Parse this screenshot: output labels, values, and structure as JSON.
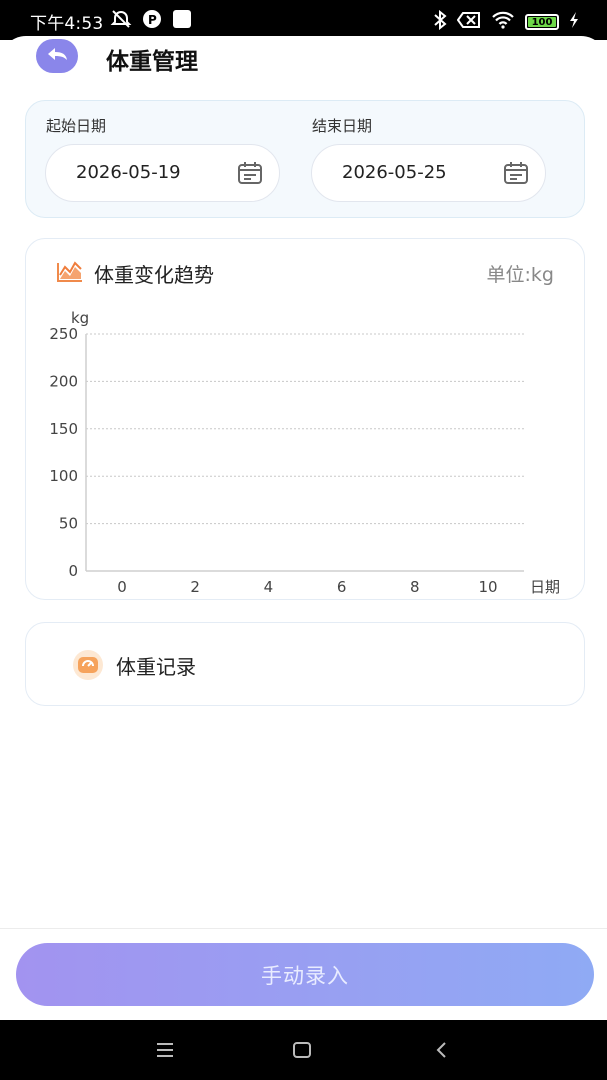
{
  "status_bar": {
    "time": "下午4:53",
    "battery": "100",
    "icons": [
      "alarm-off-icon",
      "app-icon",
      "square-icon",
      "bluetooth-icon",
      "sim-off-icon",
      "wifi-icon",
      "battery-icon",
      "charging-icon"
    ]
  },
  "header": {
    "title": "体重管理",
    "back_icon": "back-arrow-icon"
  },
  "date_range": {
    "start_label": "起始日期",
    "start_value": "2026-05-19",
    "end_label": "结束日期",
    "end_value": "2026-05-25",
    "icon": "calendar-icon"
  },
  "chart_section": {
    "title": "体重变化趋势",
    "unit": "单位:kg",
    "icon": "area-chart-icon"
  },
  "chart_data": {
    "type": "line",
    "ylabel": "kg",
    "xlabel": "日期",
    "y_ticks": [
      "250",
      "200",
      "150",
      "100",
      "50",
      "0"
    ],
    "x_ticks": [
      "0",
      "2",
      "4",
      "6",
      "8",
      "10"
    ],
    "ylim": [
      0,
      250
    ],
    "xlim": [
      0,
      10
    ],
    "grid": true,
    "series": []
  },
  "record_section": {
    "title": "体重记录",
    "icon": "scale-icon"
  },
  "bottom": {
    "button_label": "手动录入",
    "accent_start": "#a293f0",
    "accent_end": "#8faaf4"
  },
  "nav_bar": {
    "icons": [
      "menu-icon",
      "home-icon",
      "back-icon"
    ]
  }
}
